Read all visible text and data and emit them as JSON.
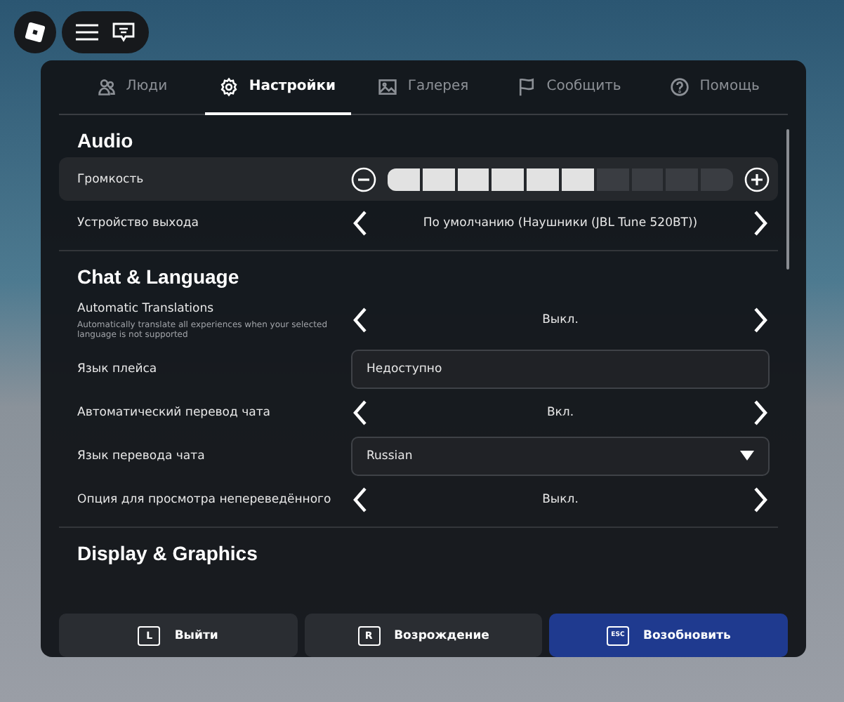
{
  "tabs": [
    {
      "label": "Люди",
      "selected": false
    },
    {
      "label": "Настройки",
      "selected": true
    },
    {
      "label": "Галерея",
      "selected": false
    },
    {
      "label": "Сообщить",
      "selected": false
    },
    {
      "label": "Помощь",
      "selected": false
    }
  ],
  "sections": [
    {
      "title": "Audio",
      "rows": [
        {
          "kind": "slider",
          "label": "Громкость",
          "level": 0.6,
          "highlighted": true
        },
        {
          "kind": "selector",
          "label": "Устройство выхода",
          "value": "По умолчанию (Наушники (JBL Tune 520BT))"
        }
      ]
    },
    {
      "title": "Chat & Language",
      "rows": [
        {
          "kind": "selector",
          "label": "Automatic Translations",
          "description": "Automatically translate all experiences when your selected language is not supported",
          "value": "Выкл."
        },
        {
          "kind": "field",
          "label": "Язык плейса",
          "value": "Недоступно"
        },
        {
          "kind": "selector",
          "label": "Автоматический перевод чата",
          "value": "Вкл."
        },
        {
          "kind": "dropdown",
          "label": "Язык перевода чата",
          "value": "Russian"
        },
        {
          "kind": "selector",
          "label": "Опция для просмотра непереведённого",
          "value": "Выкл."
        }
      ]
    },
    {
      "title": "Display & Graphics"
    }
  ],
  "buttons": [
    {
      "key": "L",
      "label": "Выйти",
      "primary": false
    },
    {
      "key": "R",
      "label": "Возрождение",
      "primary": false
    },
    {
      "key": "ESC",
      "label": "Возобновить",
      "primary": true
    }
  ]
}
